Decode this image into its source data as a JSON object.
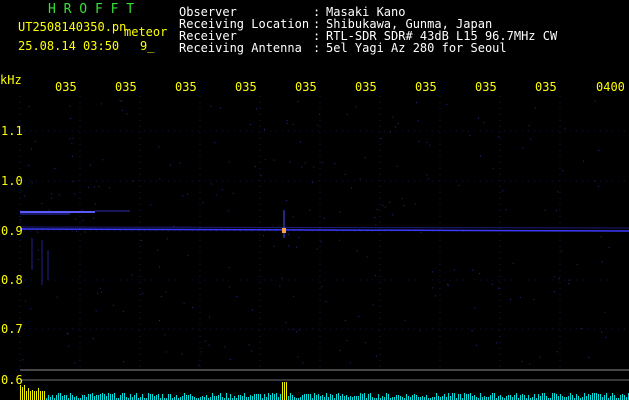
{
  "header": {
    "app_name": "H R O F F T",
    "filename": "UT2508140350.pn",
    "meteor_label": "meteor",
    "datetime": "25.08.14 03:50",
    "count": "9_",
    "info_labels": [
      "Observer",
      "Receiving Location",
      "Receiver",
      "Receiving Antenna"
    ],
    "info_colons": [
      ":",
      ":",
      ":",
      ":"
    ],
    "info_values": [
      "Masaki Kano",
      "Shibukawa, Gunma, Japan",
      "RTL-SDR SDR# 43dB L15 96.7MHz CW",
      "5el Yagi Az 280 for Seoul"
    ]
  },
  "axis": {
    "unit": "kHz",
    "time_ticks": [
      "035",
      "035",
      "035",
      "035",
      "035",
      "035",
      "035",
      "035",
      "035",
      "0400"
    ],
    "freq_ticks": [
      "1.1",
      "1.0",
      "0.9",
      "0.8",
      "0.7",
      "0.6"
    ]
  },
  "colors": {
    "background": "#000000",
    "tick_color": "#ffff00",
    "header_title": "#35e035",
    "header_text": "#ffffff",
    "echo_trace": "#3a3aff",
    "level_bars": "#00dcdc"
  }
}
